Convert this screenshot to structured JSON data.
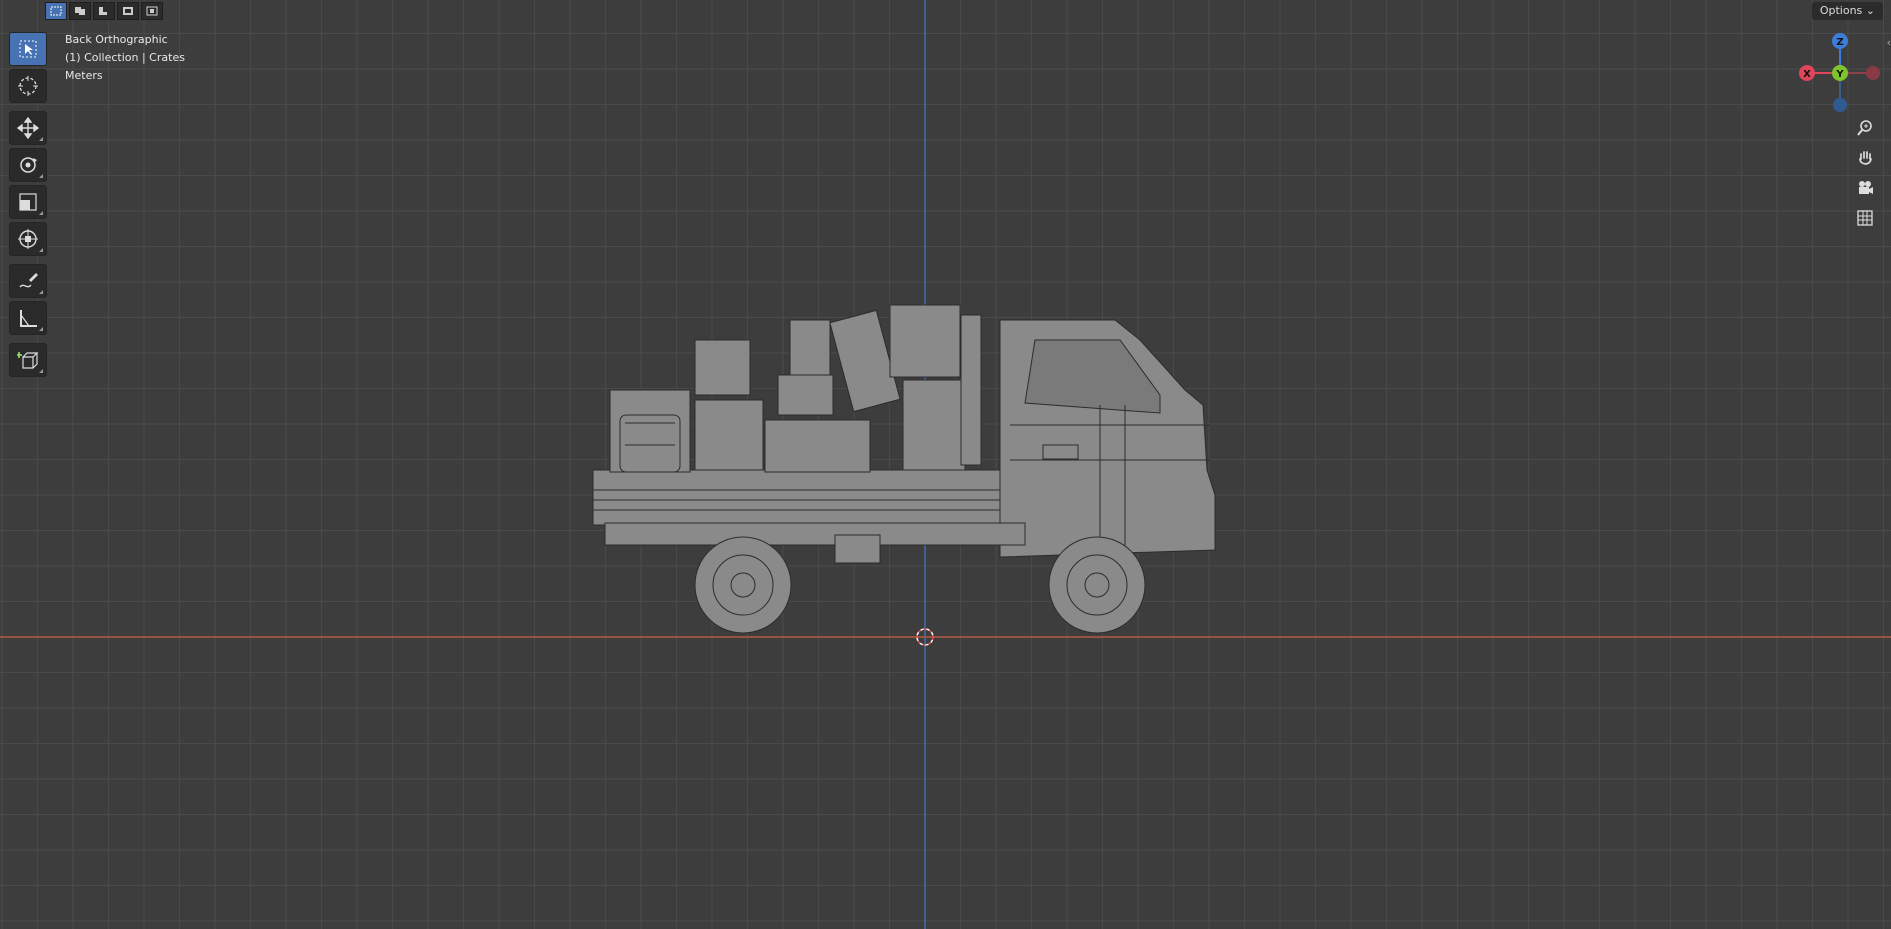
{
  "viewport": {
    "view_name": "Back Orthographic",
    "collection_info": "(1) Collection | Crates",
    "units": "Meters",
    "options_label": "Options",
    "background_color": "#3d3d3d",
    "grid_color": "#4a4a4a",
    "x_axis_color": "#b55a42",
    "z_axis_color": "#3f6fb5"
  },
  "selection_modes": [
    {
      "name": "new-selection-mode",
      "active": true
    },
    {
      "name": "extend-selection-mode",
      "active": false
    },
    {
      "name": "subtract-selection-mode",
      "active": false
    },
    {
      "name": "difference-selection-mode",
      "active": false
    },
    {
      "name": "intersect-selection-mode",
      "active": false
    }
  ],
  "toolbar": {
    "tools": [
      {
        "name": "select-box-tool",
        "icon": "cursor-arrow",
        "active": true
      },
      {
        "name": "cursor-tool",
        "icon": "3d-cursor"
      },
      {
        "name": "move-tool",
        "icon": "move-arrows"
      },
      {
        "name": "rotate-tool",
        "icon": "rotate"
      },
      {
        "name": "scale-tool",
        "icon": "scale"
      },
      {
        "name": "transform-tool",
        "icon": "transform"
      },
      {
        "name": "annotate-tool",
        "icon": "pencil"
      },
      {
        "name": "measure-tool",
        "icon": "ruler"
      },
      {
        "name": "add-cube-tool",
        "icon": "cube-plus"
      }
    ]
  },
  "gizmo": {
    "axes": [
      {
        "label": "Z",
        "color": "#3b7dd8"
      },
      {
        "label": "Y",
        "color": "#7ec42c"
      },
      {
        "label": "X",
        "color": "#e0455a"
      }
    ]
  },
  "nav_buttons": [
    {
      "name": "zoom-icon"
    },
    {
      "name": "pan-hand-icon"
    },
    {
      "name": "camera-icon"
    },
    {
      "name": "grid-icon"
    }
  ]
}
